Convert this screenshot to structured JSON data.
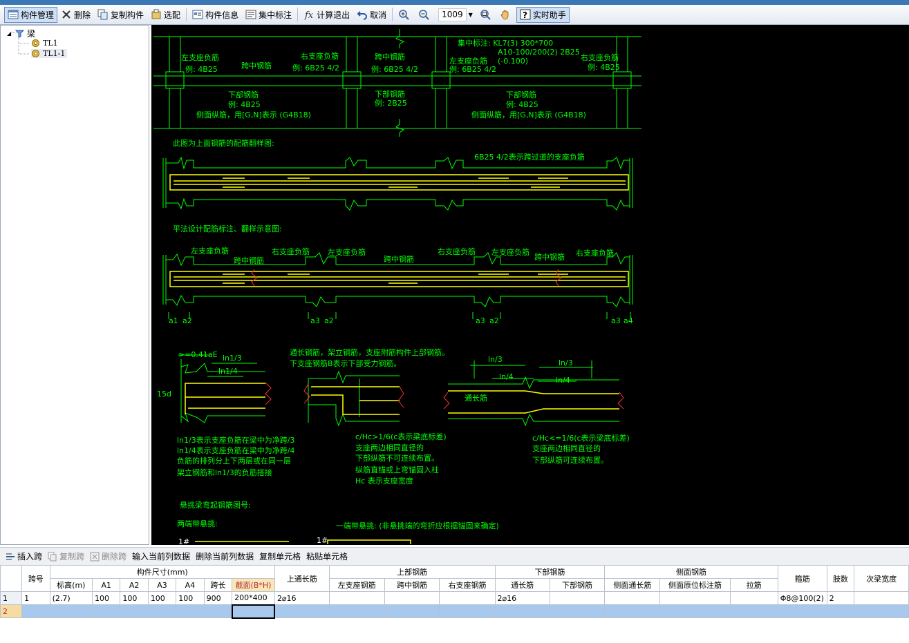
{
  "toolbar": {
    "items": [
      {
        "label": "构件管理",
        "icon": "component-manager-icon"
      },
      {
        "label": "删除",
        "icon": "delete-x-icon"
      },
      {
        "label": "复制构件",
        "icon": "copy-component-icon"
      },
      {
        "label": "选配",
        "icon": "select-match-icon"
      },
      {
        "label": "构件信息",
        "icon": "component-info-icon"
      },
      {
        "label": "集中标注",
        "icon": "centralized-label-icon"
      },
      {
        "label": "计算退出",
        "icon": "calculate-exit-icon"
      },
      {
        "label": "取消",
        "icon": "undo-icon"
      },
      {
        "label": "zoom-in",
        "icon": "zoom-in-icon"
      },
      {
        "label": "zoom-out",
        "icon": "zoom-out-icon"
      },
      {
        "label": "zoom-fit",
        "icon": "zoom-fit-icon"
      },
      {
        "label": "pan",
        "icon": "pan-hand-icon"
      },
      {
        "label": "实时助手",
        "icon": "help-assistant-icon"
      }
    ],
    "zoom_value": "1009"
  },
  "tree": {
    "root": "梁",
    "children": [
      "TL1",
      "TL1-1"
    ]
  },
  "drawing": {
    "top": {
      "left_support": "左支座负筋",
      "left_example": "例: 4B25",
      "mid_span": "跨中钢筋",
      "right_support": "右支座负筋",
      "right_example": "例: 6B25 4/2",
      "mid_span2": "跨中钢筋",
      "mid_example2": "例: 6B25 4/2",
      "bottom_steel": "下部钢筋",
      "bottom_example": "例: 4B25",
      "side_steel": "侧面纵筋，用[G,N]表示 (G4B18)",
      "bottom_steel2": "下部钢筋",
      "bottom_example2": "例: 2B25",
      "central_label": "集中标注: KL7(3) 300*700",
      "central_line2": "A10-100/200(2) 2B25",
      "central_line3": "(-0.100)",
      "left_support3": "左支座负筋",
      "left_example3": "例: 6B25 4/2",
      "right_support3": "右支座负筋",
      "right_example3": "例: 4B25",
      "bottom_steel3": "下部钢筋",
      "bottom_example3": "例: 4B25",
      "side_steel3": "侧面纵筋，用[G,N]表示 (G4B18)"
    },
    "section1_title": "此图为上面钢筋的配筋翻样图:",
    "section1_note": "6B25 4/2表示跨过道的支座负筋",
    "section2_title": "平法设计配筋标注、翻样示意图:",
    "section2_labels": [
      "左支座负筋",
      "跨中钢筋",
      "右支座负筋",
      "左支座负筋",
      "跨中钢筋",
      "右支座负筋",
      "左支座负筋",
      "跨中钢筋",
      "右支座负筋"
    ],
    "anchor_labels": [
      "a1",
      "a2",
      "a3",
      "a2",
      "a3",
      "a2",
      "a3",
      "a4"
    ],
    "detail": {
      "dim1": ">=0.41aE",
      "dim2": "ln1/3",
      "dim3": "ln1/4",
      "dim4": "15d",
      "note1": "ln1/3表示支座负筋在梁中为净跨/3",
      "note2": "ln1/4表示支座负筋在梁中为净跨/4",
      "note3": "负筋的排列分上下两层或在同一层",
      "note4": "架立钢筋和ln1/3的负筋搭接",
      "mid_title1": "通长钢筋，架立钢筋，支座附筋构件上部钢筋。",
      "mid_title2": "下支座钢筋B表示下部受力钢筋。",
      "mid_note1": "c/Hc>1/6(c表示梁底标差)",
      "mid_note2": "支座两边相同直径的",
      "mid_note3": "下部纵筋不可连续布置。",
      "mid_note4": "纵筋直锚或上弯锚固入柱",
      "mid_note5": "Hc 表示支座宽度",
      "right_dim1": "ln/3",
      "right_dim2": "ln/4",
      "right_dim3": "ln/3",
      "right_dim4": "ln/4",
      "right_label": "通长筋",
      "right_note1": "c/Hc<=1/6(c表示梁底标差)",
      "right_note2": "支座两边相同直径的",
      "right_note3": "下部纵筋可连续布置。"
    },
    "cantilever_title": "悬挑梁弯起钢筋图号:",
    "cantilever_both": "两端带悬挑:",
    "cantilever_one": "一端带悬挑: (非悬挑端的弯折应根据锚固来确定)",
    "mark1": "1#",
    "mark2": "1#"
  },
  "grid_toolbar": {
    "items": [
      {
        "label": "插入跨",
        "enabled": true,
        "icon": "insert-span-icon"
      },
      {
        "label": "复制跨",
        "enabled": false,
        "icon": "copy-span-icon"
      },
      {
        "label": "删除跨",
        "enabled": false,
        "icon": "delete-span-icon"
      },
      {
        "label": "输入当前列数据",
        "enabled": true,
        "icon": ""
      },
      {
        "label": "删除当前列数据",
        "enabled": true,
        "icon": ""
      },
      {
        "label": "复制单元格",
        "enabled": true,
        "icon": ""
      },
      {
        "label": "粘贴单元格",
        "enabled": true,
        "icon": ""
      }
    ]
  },
  "grid": {
    "group_headers": {
      "span": "跨号",
      "size": "构件尺寸(mm)",
      "top_through": "上通长筋",
      "top_steel": "上部钢筋",
      "bottom_steel": "下部钢筋",
      "side_steel": "侧面钢筋",
      "stirrup": "箍筋",
      "legs": "肢数",
      "secondary_width": "次梁宽度"
    },
    "sub_headers": [
      "标高(m)",
      "A1",
      "A2",
      "A3",
      "A4",
      "跨长",
      "截面(B*H)",
      "左支座钢筋",
      "跨中钢筋",
      "右支座钢筋",
      "通长筋",
      "下部钢筋",
      "侧面通长筋",
      "侧面原位标注筋",
      "拉筋"
    ],
    "rows": [
      {
        "num": "1",
        "span": "1",
        "elev": "(2.7)",
        "a1": "100",
        "a2": "100",
        "a3": "100",
        "a4": "100",
        "len": "900",
        "section": "200*400",
        "top_through": "2⌀16",
        "left": "",
        "mid": "",
        "right": "",
        "bot_through": "2⌀16",
        "bot": "",
        "side_through": "",
        "side_orig": "",
        "tie": "",
        "stirrup": "Φ8@100(2)",
        "legs": "2",
        "sec_w": ""
      },
      {
        "num": "2",
        "span": "",
        "elev": "",
        "a1": "",
        "a2": "",
        "a3": "",
        "a4": "",
        "len": "",
        "section": "",
        "top_through": "",
        "left": "",
        "mid": "",
        "right": "",
        "bot_through": "",
        "bot": "",
        "side_through": "",
        "side_orig": "",
        "tie": "",
        "stirrup": "",
        "legs": "",
        "sec_w": ""
      }
    ]
  }
}
